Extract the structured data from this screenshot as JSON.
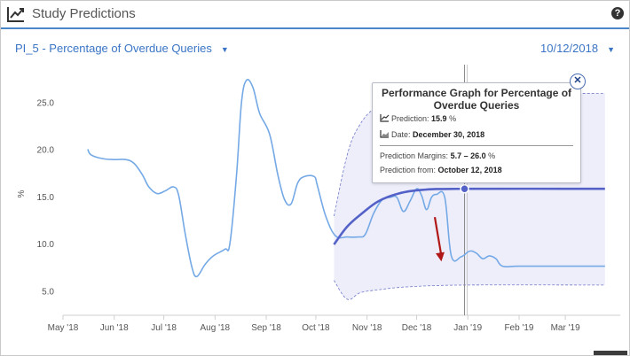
{
  "header": {
    "title": "Study Predictions",
    "icon": "trend-chart-icon",
    "help_icon": "question-circle-icon"
  },
  "controls": {
    "metric_label": "PI_5 - Percentage of Overdue Queries",
    "date_label": "10/12/2018",
    "caret": "▼"
  },
  "tooltip": {
    "title": "Performance Graph for Percentage of Overdue Queries",
    "prediction_label": "Prediction:",
    "prediction_value": "15.9",
    "prediction_unit": "%",
    "date_label": "Date:",
    "date_value": "December 30, 2018",
    "margins_label": "Prediction Margins:",
    "margins_value": "5.7 – 26.0",
    "margins_unit": "%",
    "from_label": "Prediction from:",
    "from_value": "October 12, 2018",
    "close_icon": "close-icon"
  },
  "colors": {
    "actual_line": "#74a9e6",
    "prediction_line": "#5462c8",
    "margin_band": "#eeeefb",
    "margin_border": "#6f79c9",
    "arrow": "#b01818",
    "crosshair": "#888888"
  },
  "chart_data": {
    "type": "line",
    "ylabel": "%",
    "ylim": [
      2.5,
      28.5
    ],
    "y_ticks": [
      5.0,
      10.0,
      15.0,
      20.0,
      25.0
    ],
    "y_tick_labels": [
      "5.0",
      "10.0",
      "15.0",
      "20.0",
      "25.0"
    ],
    "x_range": [
      "2018-05-01",
      "2019-03-31"
    ],
    "x_tick_dates": [
      "2018-05-01",
      "2018-06-01",
      "2018-07-01",
      "2018-08-01",
      "2018-09-01",
      "2018-10-01",
      "2018-11-01",
      "2018-12-01",
      "2019-01-01",
      "2019-02-01",
      "2019-03-01"
    ],
    "x_tick_labels": [
      "May '18",
      "Jun '18",
      "Jul '18",
      "Aug '18",
      "Sep '18",
      "Oct '18",
      "Nov '18",
      "Dec '18",
      "Jan '19",
      "Feb '19",
      "Mar '19"
    ],
    "series": [
      {
        "key": "actual",
        "points": [
          [
            "2018-05-16",
            20.1
          ],
          [
            "2018-05-18",
            19.5
          ],
          [
            "2018-05-25",
            19.1
          ],
          [
            "2018-06-01",
            19.0
          ],
          [
            "2018-06-08",
            19.0
          ],
          [
            "2018-06-13",
            18.6
          ],
          [
            "2018-06-18",
            17.4
          ],
          [
            "2018-06-22",
            16.1
          ],
          [
            "2018-06-27",
            15.4
          ],
          [
            "2018-07-02",
            15.7
          ],
          [
            "2018-07-07",
            16.1
          ],
          [
            "2018-07-10",
            15.2
          ],
          [
            "2018-07-14",
            11.1
          ],
          [
            "2018-07-18",
            7.6
          ],
          [
            "2018-07-21",
            6.6
          ],
          [
            "2018-07-26",
            7.9
          ],
          [
            "2018-07-31",
            8.8
          ],
          [
            "2018-08-07",
            9.5
          ],
          [
            "2018-08-10",
            10.1
          ],
          [
            "2018-08-14",
            17.3
          ],
          [
            "2018-08-17",
            25.0
          ],
          [
            "2018-08-20",
            27.4
          ],
          [
            "2018-08-24",
            26.6
          ],
          [
            "2018-08-28",
            23.9
          ],
          [
            "2018-09-03",
            21.7
          ],
          [
            "2018-09-08",
            17.4
          ],
          [
            "2018-09-12",
            14.8
          ],
          [
            "2018-09-16",
            14.3
          ],
          [
            "2018-09-20",
            16.5
          ],
          [
            "2018-09-24",
            17.2
          ],
          [
            "2018-09-30",
            17.2
          ],
          [
            "2018-10-02",
            16.2
          ],
          [
            "2018-10-07",
            13.0
          ],
          [
            "2018-10-13",
            10.9
          ],
          [
            "2018-10-20",
            10.8
          ],
          [
            "2018-10-27",
            10.8
          ],
          [
            "2018-10-31",
            11.1
          ],
          [
            "2018-11-05",
            13.3
          ],
          [
            "2018-11-10",
            14.7
          ],
          [
            "2018-11-15",
            15.0
          ],
          [
            "2018-11-19",
            15.0
          ],
          [
            "2018-11-23",
            13.5
          ],
          [
            "2018-11-27",
            14.6
          ],
          [
            "2018-12-01",
            15.9
          ],
          [
            "2018-12-04",
            15.2
          ],
          [
            "2018-12-07",
            13.7
          ],
          [
            "2018-12-10",
            15.0
          ],
          [
            "2018-12-13",
            15.3
          ],
          [
            "2018-12-18",
            15.0
          ],
          [
            "2018-12-22",
            8.8
          ],
          [
            "2018-12-28",
            8.7
          ],
          [
            "2019-01-02",
            9.3
          ],
          [
            "2019-01-06",
            9.1
          ],
          [
            "2019-01-10",
            8.5
          ],
          [
            "2019-01-14",
            8.8
          ],
          [
            "2019-01-18",
            8.5
          ],
          [
            "2019-01-22",
            7.7
          ],
          [
            "2019-02-01",
            7.7
          ],
          [
            "2019-03-01",
            7.7
          ],
          [
            "2019-03-25",
            7.7
          ]
        ]
      },
      {
        "key": "prediction",
        "points": [
          [
            "2018-10-12",
            10.0
          ],
          [
            "2018-10-20",
            11.9
          ],
          [
            "2018-10-29",
            13.3
          ],
          [
            "2018-11-08",
            14.6
          ],
          [
            "2018-11-20",
            15.4
          ],
          [
            "2018-12-05",
            15.8
          ],
          [
            "2018-12-30",
            15.9
          ],
          [
            "2019-03-25",
            15.9
          ]
        ]
      },
      {
        "key": "margin_upper",
        "points": [
          [
            "2018-10-12",
            13.0
          ],
          [
            "2018-10-20",
            19.5
          ],
          [
            "2018-10-27",
            22.5
          ],
          [
            "2018-11-06",
            24.5
          ],
          [
            "2018-11-20",
            25.4
          ],
          [
            "2018-12-10",
            25.8
          ],
          [
            "2018-12-30",
            26.0
          ],
          [
            "2019-03-25",
            26.0
          ]
        ]
      },
      {
        "key": "margin_lower",
        "points": [
          [
            "2018-10-12",
            6.2
          ],
          [
            "2018-10-20",
            4.2
          ],
          [
            "2018-10-28",
            4.9
          ],
          [
            "2018-11-08",
            5.2
          ],
          [
            "2018-11-25",
            5.5
          ],
          [
            "2018-12-30",
            5.7
          ],
          [
            "2019-03-25",
            5.7
          ]
        ]
      }
    ],
    "crosshair_date": "2018-12-30",
    "highlight_point": [
      "2018-12-30",
      15.9
    ],
    "annotation_arrow": {
      "from": [
        "2018-12-12",
        12.9
      ],
      "to": [
        "2018-12-16",
        8.2
      ]
    }
  }
}
